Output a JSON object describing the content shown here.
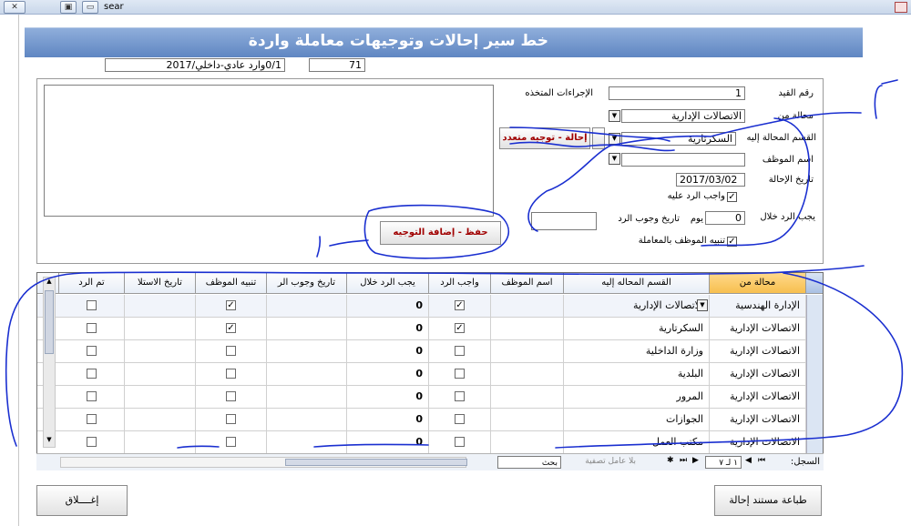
{
  "toolbar": {
    "search_text": "sear"
  },
  "header": {
    "title": "خط سير إحالات وتوجيهات معاملة واردة"
  },
  "top_fields": {
    "transaction_ref": "0/1وارد عادي-داخلي/2017",
    "transaction_no": "71"
  },
  "form": {
    "actions_label": "الإجراءات المتخذه",
    "entry_no_label": "رقم القيد",
    "entry_no_value": "1",
    "referred_from_label": "محالة من",
    "referred_from_value": "الاتصالات الإدارية",
    "dept_label": "القسم المحالة إليه",
    "dept_value": "السكرتارية",
    "employee_label": "اسم الموظف",
    "employee_value": "",
    "date_label": "تاريخ الإحالة",
    "date_value": "2017/03/02",
    "reply_required_label": "واجب الرد عليه",
    "reply_within_label": "يجب الرد خلال",
    "reply_within_value": "0",
    "day_label": "يوم",
    "reply_date_label": "تاريخ وجوب الرد",
    "reply_date_value": "",
    "notify_label": "تنبيه الموظف بالمعاملة",
    "multi_referral_button": "إحالة - توجيه متعدد",
    "save_button": "حفظ - إضافة التوجيه"
  },
  "grid": {
    "columns": [
      "محالة من",
      "القسم المحاله إليه",
      "اسم الموظف",
      "واجب الرد",
      "يجب الرد خلال",
      "تاريخ وجوب الر",
      "تنبيه الموظف",
      "تاريخ الاستلا",
      "تم الرد"
    ],
    "rows": [
      {
        "from": "الإدارة الهندسية",
        "dept": "الاتصالات الإدارية",
        "employee": "",
        "reply_required": true,
        "within": "0",
        "reply_date": "",
        "notify": true,
        "received": "",
        "replied": false
      },
      {
        "from": "الاتصالات الإدارية",
        "dept": "السكرتارية",
        "employee": "",
        "reply_required": true,
        "within": "0",
        "reply_date": "",
        "notify": true,
        "received": "",
        "replied": false
      },
      {
        "from": "الاتصالات الإدارية",
        "dept": "وزارة الداخلية",
        "employee": "",
        "reply_required": false,
        "within": "0",
        "reply_date": "",
        "notify": false,
        "received": "",
        "replied": false
      },
      {
        "from": "الاتصالات الإدارية",
        "dept": "البلدية",
        "employee": "",
        "reply_required": false,
        "within": "0",
        "reply_date": "",
        "notify": false,
        "received": "",
        "replied": false
      },
      {
        "from": "الاتصالات الإدارية",
        "dept": "المرور",
        "employee": "",
        "reply_required": false,
        "within": "0",
        "reply_date": "",
        "notify": false,
        "received": "",
        "replied": false
      },
      {
        "from": "الاتصالات الإدارية",
        "dept": "الجوازات",
        "employee": "",
        "reply_required": false,
        "within": "0",
        "reply_date": "",
        "notify": false,
        "received": "",
        "replied": false
      },
      {
        "from": "الاتصالات الإدارية",
        "dept": "مكتب العمل",
        "employee": "",
        "reply_required": false,
        "within": "0",
        "reply_date": "",
        "notify": false,
        "received": "",
        "replied": false
      }
    ]
  },
  "navigation": {
    "record_label": "السجل:",
    "record_position": "١ لـ ٧",
    "no_filter": "بلا عامل تصفية",
    "search": "بحث"
  },
  "footer": {
    "print_button": "طباعة مستند إحالة",
    "close_button": "إغــــلاق"
  },
  "colors": {
    "header_top": "#8faedb",
    "header_bottom": "#5f86c2",
    "selected_header": "#f7bf4f",
    "ink": "#1a2fd0",
    "button_red": "#a00000"
  }
}
